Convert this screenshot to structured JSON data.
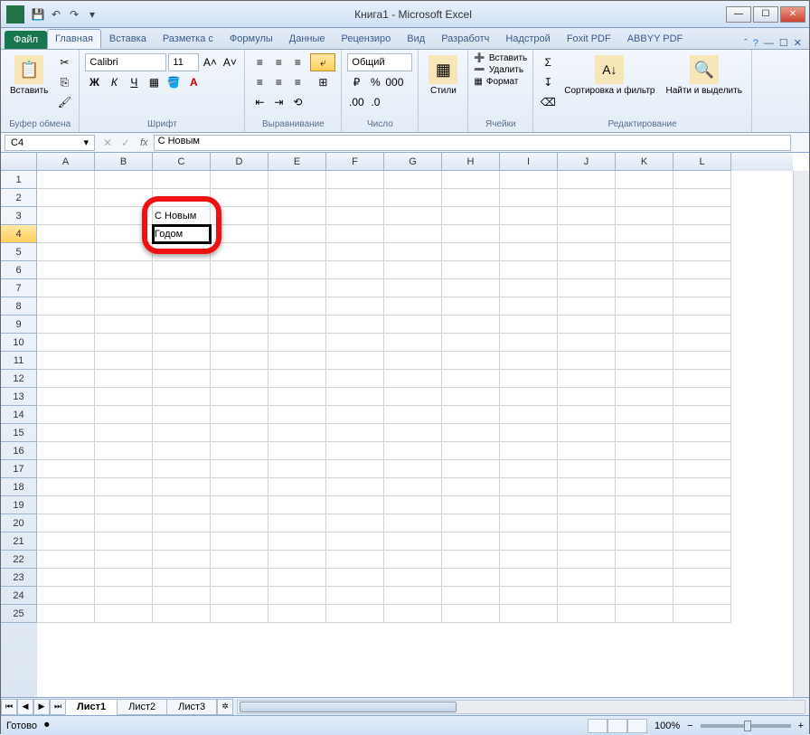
{
  "app": {
    "title": "Книга1  -  Microsoft Excel"
  },
  "tabs": {
    "file": "Файл",
    "items": [
      "Главная",
      "Вставка",
      "Разметка с",
      "Формулы",
      "Данные",
      "Рецензиро",
      "Вид",
      "Разработч",
      "Надстрой",
      "Foxit PDF",
      "ABBYY PDF"
    ],
    "active": 0
  },
  "ribbon": {
    "clipboard": {
      "paste": "Вставить",
      "label": "Буфер обмена"
    },
    "font": {
      "name": "Calibri",
      "size": "11",
      "label": "Шрифт"
    },
    "alignment": {
      "label": "Выравнивание"
    },
    "number": {
      "format": "Общий",
      "label": "Число"
    },
    "styles": {
      "btn": "Стили",
      "label": ""
    },
    "cells": {
      "insert": "Вставить",
      "delete": "Удалить",
      "format": "Формат",
      "label": "Ячейки"
    },
    "editing": {
      "sort": "Сортировка и фильтр",
      "find": "Найти и выделить",
      "label": "Редактирование"
    }
  },
  "formula_bar": {
    "name_box": "C4",
    "fx": "fx",
    "content": "С Новым"
  },
  "grid": {
    "columns": [
      "A",
      "B",
      "C",
      "D",
      "E",
      "F",
      "G",
      "H",
      "I",
      "J",
      "K",
      "L"
    ],
    "rows": 25,
    "selected_row": 4,
    "cells": {
      "C3": "С Новым",
      "C4": "Годом"
    },
    "selection": {
      "col": 2,
      "row": 3
    }
  },
  "sheets": {
    "tabs": [
      "Лист1",
      "Лист2",
      "Лист3"
    ],
    "active": 0
  },
  "status": {
    "ready": "Готово",
    "zoom": "100%"
  }
}
